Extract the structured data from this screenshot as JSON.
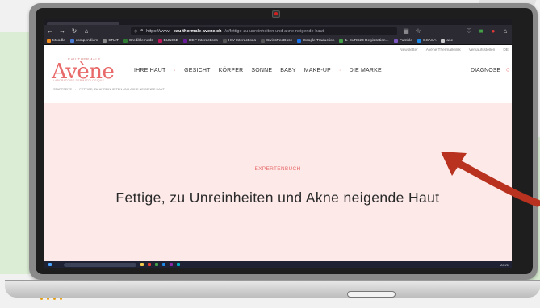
{
  "browser": {
    "url_prefix": "https://www.",
    "url_host": "eau-thermale-avene.ch",
    "url_path": "/a/fettige-zu-unreinheiten-und-akne-neigende-haut",
    "bookmarks": [
      {
        "label": "Moodle",
        "color": "#f28c1b"
      },
      {
        "label": "compendium",
        "color": "#4a7bd0"
      },
      {
        "label": "CRAT",
        "color": "#888888"
      },
      {
        "label": "Crediblemeds",
        "color": "#2e7d32"
      },
      {
        "label": "BUNIGE",
        "color": "#c2185b"
      },
      {
        "label": "HEP Interactions",
        "color": "#6a1b9a"
      },
      {
        "label": "HIV Interactions",
        "color": "#555555"
      },
      {
        "label": "SwissPedDose",
        "color": "#555555"
      },
      {
        "label": "Google Traduction",
        "color": "#1a73e8"
      },
      {
        "label": "1. EuRS23 Registration...",
        "color": "#43a047"
      },
      {
        "label": "Pumble",
        "color": "#7e57c2"
      },
      {
        "label": "GSASA",
        "color": "#1e88e5"
      },
      {
        "label": "ase",
        "color": "#cccccc"
      }
    ]
  },
  "site": {
    "utility_links": [
      "Newsletter",
      "Avène Thermalklinik",
      "Verkaufsstellen",
      "DE"
    ],
    "logo": {
      "sub": "EAU THERMALE",
      "main": "Avène",
      "tag": "LABORATOIRE DERMATOLOGIQUE"
    },
    "nav": [
      "IHRE HAUT",
      "GESICHT",
      "KÖRPER",
      "SONNE",
      "BABY",
      "MAKE-UP",
      "DIE MARKE"
    ],
    "diagnose": "DIAGNOSE",
    "breadcrumb": [
      "STARTSEITE",
      "FETTIGE, ZU UNREINHEITEN UND AKNE NEIGENDE HAUT"
    ],
    "hero": {
      "kicker": "EXPERTENBUCH",
      "title": "Fettige, zu Unreinheiten und Akne neigende Haut"
    }
  },
  "colors": {
    "accent": "#e86a6a",
    "hero_bg": "#fce9e8",
    "arrow": "#b8321f"
  },
  "taskbar": {
    "clock": "22:21"
  }
}
